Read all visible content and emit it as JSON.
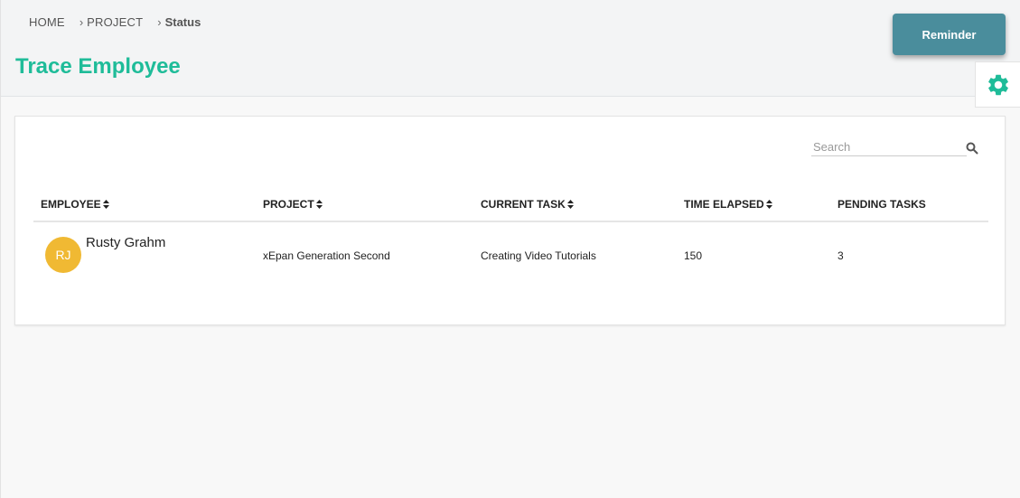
{
  "breadcrumb": {
    "home": "HOME",
    "project": "PROJECT",
    "current": "Status"
  },
  "page": {
    "title": "Trace Employee"
  },
  "actions": {
    "reminder_label": "Reminder"
  },
  "settings": {
    "icon": "gear-icon",
    "color": "#1fbc99"
  },
  "search": {
    "placeholder": "Search",
    "value": ""
  },
  "table": {
    "columns": [
      "EMPLOYEE",
      "PROJECT",
      "CURRENT TASK",
      "TIME ELAPSED",
      "PENDING TASKS"
    ],
    "rows": [
      {
        "avatar_initials": "RJ",
        "employee": "Rusty Grahm",
        "project": "xEpan Generation Second",
        "current_task": "Creating Video Tutorials",
        "time_elapsed": "150",
        "pending_tasks": "3"
      }
    ]
  },
  "colors": {
    "accent": "#1fbc99",
    "button": "#4a8d9c",
    "avatar": "#f0b933"
  }
}
